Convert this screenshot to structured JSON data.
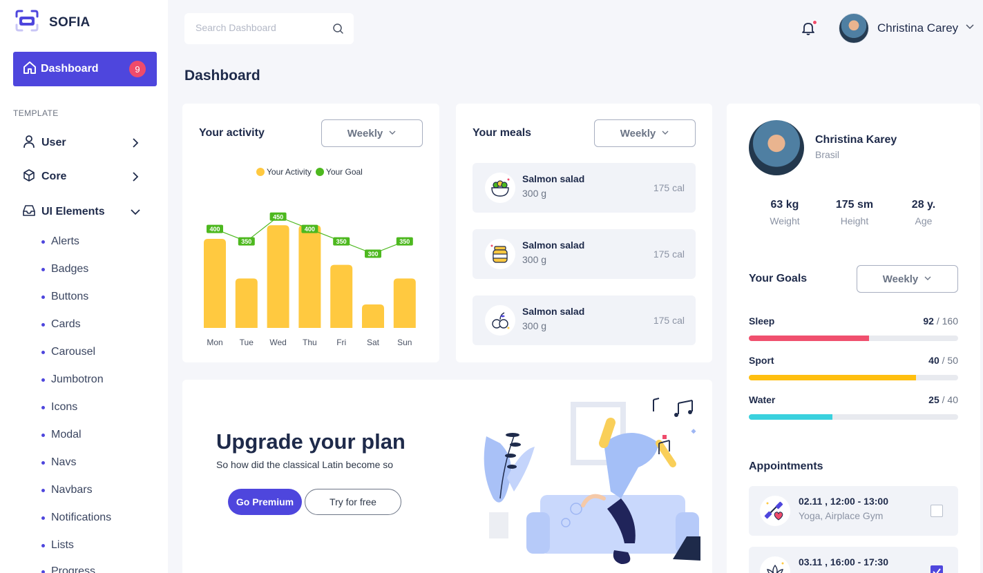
{
  "brand": {
    "name": "SOFIA",
    "logo_icon": "camera-scan-icon",
    "accent": "#4e46dd"
  },
  "sidebar": {
    "dashboard": {
      "label": "Dashboard",
      "badge": "9"
    },
    "section_title": "TEMPLATE",
    "groups": [
      {
        "label": "User",
        "icon": "user-icon",
        "expanded": false
      },
      {
        "label": "Core",
        "icon": "cube-icon",
        "expanded": false
      },
      {
        "label": "UI Elements",
        "icon": "inbox-icon",
        "expanded": true
      }
    ],
    "sub_items": [
      "Alerts",
      "Badges",
      "Buttons",
      "Cards",
      "Carousel",
      "Jumbotron",
      "Icons",
      "Modal",
      "Navs",
      "Navbars",
      "Notifications",
      "Lists",
      "Progress"
    ]
  },
  "topbar": {
    "search_placeholder": "Search Dashboard",
    "user_name": "Christina Carey"
  },
  "page_title": "Dashboard",
  "activity": {
    "title": "Your activity",
    "period": "Weekly",
    "legend_activity": "Your Activity",
    "legend_goal": "Your Goal",
    "activity_color": "#ffc940",
    "goal_color": "#4db81f"
  },
  "chart_data": {
    "type": "bar",
    "categories": [
      "Mon",
      "Tue",
      "Wed",
      "Thu",
      "Fri",
      "Sat",
      "Sun"
    ],
    "series": [
      {
        "name": "Your Activity",
        "type": "bar",
        "values": [
          360,
          200,
          415,
          415,
          255,
          95,
          200
        ]
      },
      {
        "name": "Your Goal",
        "type": "line",
        "values": [
          400,
          350,
          450,
          400,
          350,
          300,
          350
        ]
      }
    ],
    "ylim": [
      0,
      600
    ],
    "grid": false,
    "legend": "top-center"
  },
  "meals": {
    "title": "Your meals",
    "period": "Weekly",
    "items": [
      {
        "name": "Salmon salad",
        "weight": "300 g",
        "calories": "175 cal",
        "icon": "salad-bowl-icon"
      },
      {
        "name": "Salmon salad",
        "weight": "300 g",
        "calories": "175 cal",
        "icon": "honey-jar-icon"
      },
      {
        "name": "Salmon salad",
        "weight": "300 g",
        "calories": "175 cal",
        "icon": "fruit-icon"
      }
    ]
  },
  "upgrade": {
    "title": "Upgrade your plan",
    "subtitle": "So how did the classical Latin become so",
    "primary_button": "Go Premium",
    "secondary_button": "Try for free"
  },
  "profile": {
    "name": "Christina Karey",
    "location": "Brasil",
    "stats": [
      {
        "value": "63 kg",
        "label": "Weight"
      },
      {
        "value": "175 sm",
        "label": "Height"
      },
      {
        "value": "28 y.",
        "label": "Age"
      }
    ]
  },
  "goals": {
    "title": "Your Goals",
    "period": "Weekly",
    "items": [
      {
        "name": "Sleep",
        "current": "92",
        "total": "/ 160",
        "progress": 0.575,
        "color": "#f0506e"
      },
      {
        "name": "Sport",
        "current": "40",
        "total": "/ 50",
        "progress": 0.8,
        "color": "#ffbf0f"
      },
      {
        "name": "Water",
        "current": "25",
        "total": "/ 40",
        "progress": 0.4,
        "color": "#3ad1de"
      }
    ]
  },
  "appointments": {
    "title": "Appointments",
    "items": [
      {
        "time": "02.11 , 12:00 - 13:00",
        "place": "Yoga, Airplace Gym",
        "icon": "dumbbell-heart-icon",
        "checked": false
      },
      {
        "time": "03.11 , 16:00 - 17:30",
        "place": "",
        "icon": "lotus-icon",
        "checked": true
      }
    ]
  }
}
